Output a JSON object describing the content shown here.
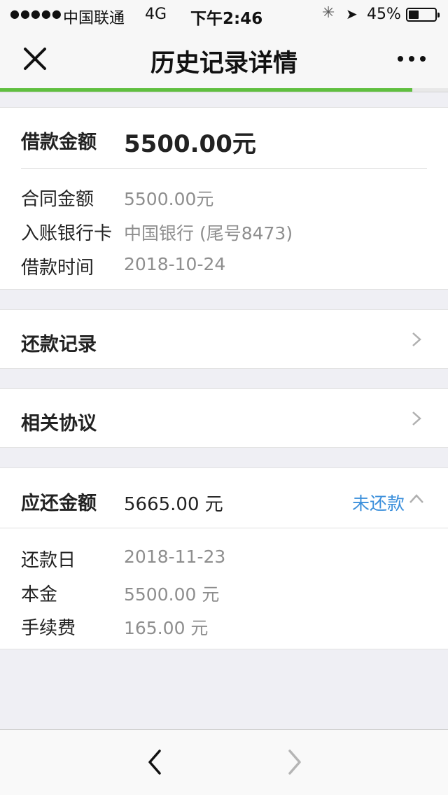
{
  "status_bar": {
    "signal": "●●●●●",
    "carrier": "中国联通",
    "network": "4G",
    "time": "下午2:46",
    "battery_percent": "45%",
    "battery_level": 0.45
  },
  "nav": {
    "title": "历史记录详情",
    "progress": 0.92
  },
  "loan": {
    "amount_label": "借款金额",
    "amount_value": "5500.00元",
    "contract_label": "合同金额",
    "contract_value": "5500.00元",
    "card_label": "入账银行卡",
    "card_value": "中国银行 (尾号8473)",
    "time_label": "借款时间",
    "time_value": "2018-10-24"
  },
  "rows": {
    "repay_record": "还款记录",
    "agreements": "相关协议"
  },
  "due": {
    "label": "应还金额",
    "value": "5665.00 元",
    "status": "未还款",
    "due_date_label": "还款日",
    "due_date_value": "2018-11-23",
    "principal_label": "本金",
    "principal_value": "5500.00 元",
    "fee_label": "手续费",
    "fee_value": "165.00 元"
  },
  "colors": {
    "accent_green": "#5fbf3f",
    "link_blue": "#3b8fdb"
  }
}
